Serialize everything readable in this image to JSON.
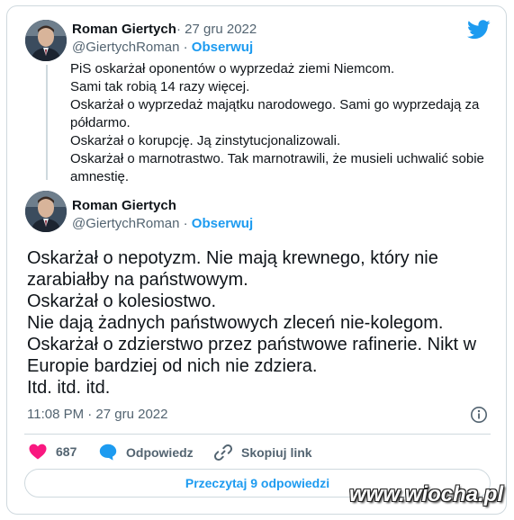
{
  "quoted_tweet": {
    "author_name": "Roman Giertych",
    "separator": "·",
    "date": "27 gru 2022",
    "handle": "@GiertychRoman",
    "follow_label": "Obserwuj",
    "lines": [
      "PiS oskarżał oponentów o wyprzedaż ziemi Niemcom.",
      "Sami tak robią 14 razy więcej.",
      "Oskarżał o wyprzedaż majątku narodowego. Sami go wyprzedają za",
      "półdarmo.",
      "Oskarżał o korupcję. Ją zinstytucjonalizowali.",
      "Oskarżał o marnotrastwo. Tak marnotrawili, że musieli uchwalić sobie",
      "amnestię."
    ]
  },
  "main_tweet": {
    "author_name": "Roman Giertych",
    "handle": "@GiertychRoman",
    "follow_label": "Obserwuj",
    "lines": [
      "Oskarżał o nepotyzm. Nie mają krewnego, który nie",
      "zarabiałby na państwowym.",
      "Oskarżał o kolesiostwo.",
      "Nie dają żadnych państwowych zleceń nie-kolegom.",
      "Oskarżał o zdzierstwo przez państwowe rafinerie. Nikt w",
      "Europie bardziej od nich nie zdziera.",
      "Itd. itd. itd."
    ],
    "timestamp": "11:08 PM · 27 gru 2022"
  },
  "actions": {
    "like_count": "687",
    "reply_label": "Odpowiedz",
    "copy_link_label": "Skopiuj link"
  },
  "read_replies_label": "Przeczytaj 9 odpowiedzi",
  "watermark": "www.wiocha.pl",
  "icons": {
    "brand": "twitter-bird-icon",
    "like": "heart-icon",
    "reply": "speech-bubble-icon",
    "copy": "link-icon",
    "info": "info-icon"
  },
  "colors": {
    "accent": "#1d9bf0",
    "like": "#f91880",
    "text": "#0f1419",
    "secondary": "#536471",
    "border": "#cfd9de"
  }
}
